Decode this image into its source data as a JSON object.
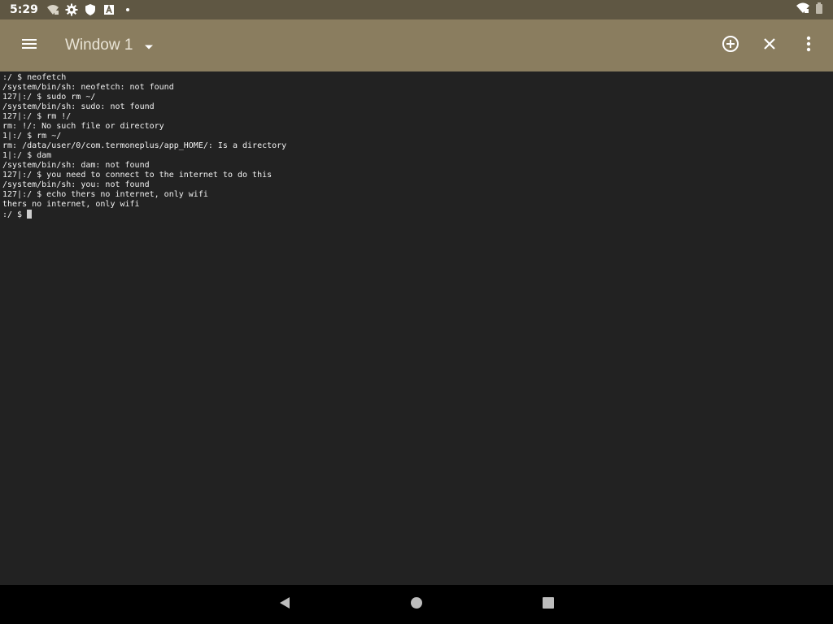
{
  "status_bar": {
    "time": "5:29",
    "icons": [
      "wifi-calling-icon",
      "gear-icon",
      "shield-icon",
      "font-a-icon",
      "dot-icon"
    ],
    "right_icons": [
      "wifi-icon",
      "battery-icon"
    ]
  },
  "toolbar": {
    "menu_icon": "hamburger-menu-icon",
    "window_title": "Window 1",
    "dropdown_icon": "dropdown-arrow-icon",
    "actions": [
      "add-window-icon",
      "close-window-icon",
      "more-vert-icon"
    ],
    "color": "#8a7d5f"
  },
  "terminal": {
    "lines": [
      ":/ $ neofetch",
      "/system/bin/sh: neofetch: not found",
      "127|:/ $ sudo rm ~/",
      "/system/bin/sh: sudo: not found",
      "127|:/ $ rm !/",
      "rm: !/: No such file or directory",
      "1|:/ $ rm ~/",
      "rm: /data/user/0/com.termoneplus/app_HOME/: Is a directory",
      "1|:/ $ dam",
      "/system/bin/sh: dam: not found",
      "127|:/ $ you need to connect to the internet to do this",
      "/system/bin/sh: you: not found",
      "127|:/ $ echo thers no internet, only wifi",
      "thers no internet, only wifi"
    ],
    "prompt": ":/ $ ",
    "background": "#222222",
    "foreground": "#f2f2f2"
  },
  "nav_bar": {
    "buttons": [
      "back-icon",
      "home-icon",
      "recents-icon"
    ]
  }
}
